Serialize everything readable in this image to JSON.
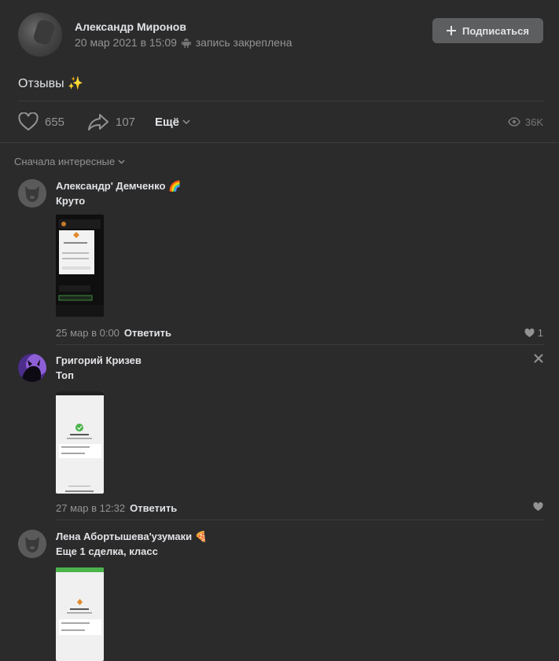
{
  "post": {
    "author": "Александр Миронов",
    "date": "20 мар 2021 в 15:09",
    "pinned": "запись закреплена",
    "subscribe_label": "Подписаться",
    "text": "Отзывы ✨",
    "likes": "655",
    "shares": "107",
    "more_label": "Ещё",
    "views": "36K"
  },
  "comments_sort": "Сначала интересные",
  "comments": [
    {
      "name": "Александр' Демченко 🌈",
      "text": "Круто",
      "date": "25 мар в 0:00",
      "reply": "Ответить",
      "likes": "1"
    },
    {
      "name": "Григорий Кризев",
      "text": "Топ",
      "date": "27 мар в 12:32",
      "reply": "Ответить",
      "likes": ""
    },
    {
      "name": "Лена Абортышева'узумаки 🍕",
      "text": "Еще 1 сделка, класс"
    }
  ],
  "colors": {
    "background": "#2b2b2c",
    "button": "#5d5e60",
    "text": "#e1e3e6",
    "muted": "#939393",
    "success": "#4bb34b"
  }
}
